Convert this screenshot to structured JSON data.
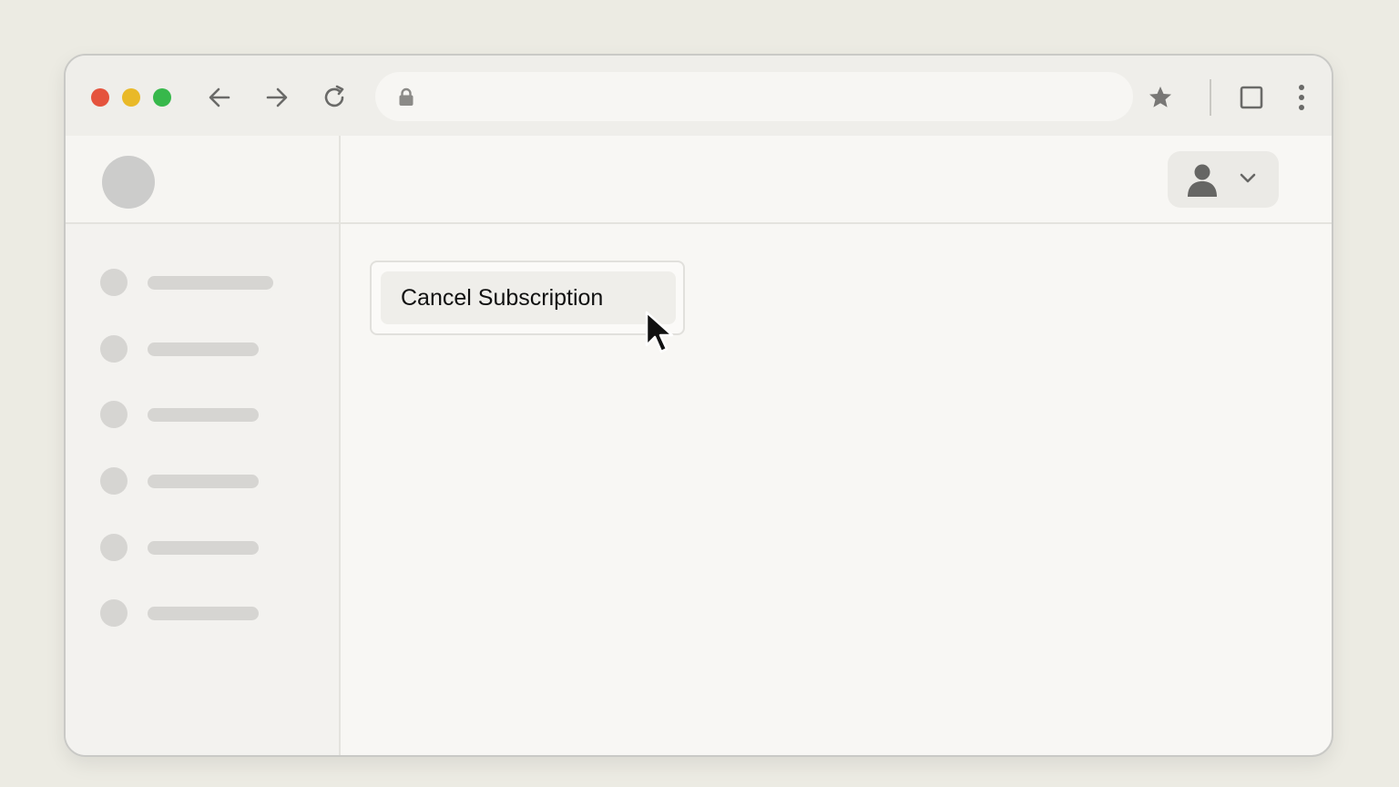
{
  "browser": {
    "address": {
      "url": ""
    },
    "icons": {
      "back": "back-arrow-icon",
      "forward": "forward-arrow-icon",
      "reload": "reload-icon",
      "lock": "lock-icon",
      "bookmark": "star-icon",
      "tab": "square-icon",
      "menu": "more-vertical-icon"
    },
    "colors": {
      "close": "#e5533d",
      "minimize": "#e9b928",
      "maximize": "#37b84b"
    }
  },
  "sidebar": {
    "logo": "logo-placeholder",
    "items": [
      {
        "label": ""
      },
      {
        "label": ""
      },
      {
        "label": ""
      },
      {
        "label": ""
      },
      {
        "label": ""
      },
      {
        "label": ""
      }
    ]
  },
  "header": {
    "profile_icon": "user-icon",
    "profile_menu_icon": "chevron-down-icon"
  },
  "main": {
    "cancel_button_label": "Cancel Subscription"
  }
}
